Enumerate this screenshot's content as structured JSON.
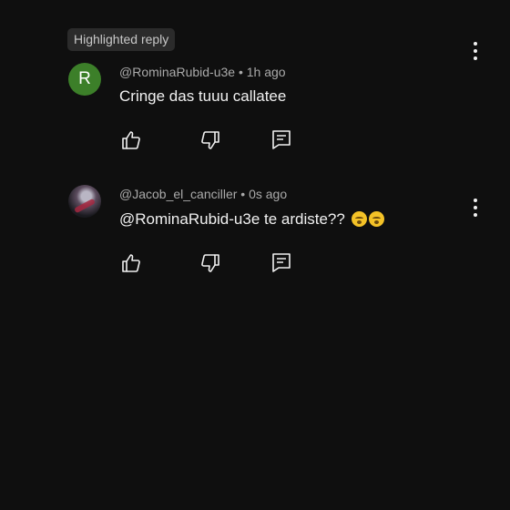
{
  "badge": "Highlighted reply",
  "comments": [
    {
      "avatar_letter": "R",
      "author": "@RominaRubid-u3e",
      "separator": "•",
      "time": "1h ago",
      "text": "Cringe  das tuuu callatee",
      "avatar_color": "#3c7f29"
    },
    {
      "avatar_letter": "",
      "author": "@Jacob_el_canciller",
      "separator": "•",
      "time": "0s ago",
      "text": "@RominaRubid-u3e  te ardiste??",
      "emojis": [
        "yawning-face",
        "yawning-face"
      ]
    }
  ],
  "actions": [
    "like-icon",
    "dislike-icon",
    "reply-icon"
  ],
  "colors": {
    "background": "#0f0f0f",
    "text": "#f1f1f1",
    "meta": "#aaaaaa",
    "badge_bg": "#2b2b2b"
  }
}
